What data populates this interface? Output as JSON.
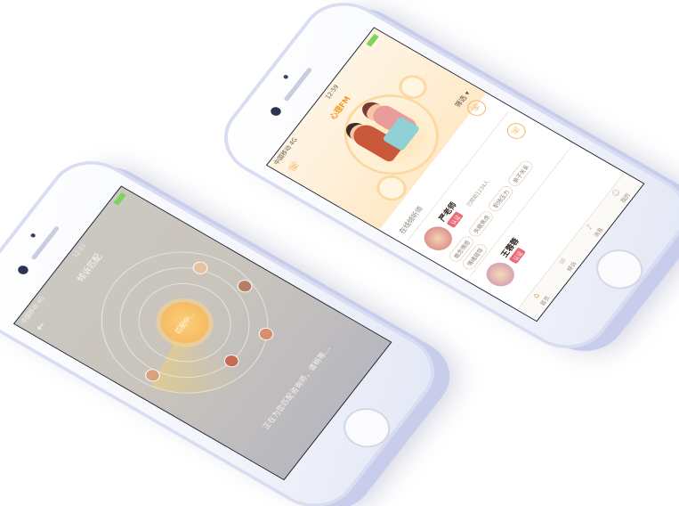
{
  "left_phone": {
    "status": {
      "carrier": "中国移动 4G",
      "time": "12:01"
    },
    "nav": {
      "back_icon": "back-arrow-icon",
      "title": "倾诉匹配"
    },
    "radar": {
      "center_label": "匹配中..."
    },
    "waiting_text": "正在为您匹配咨询师，请稍等..."
  },
  "right_phone": {
    "status": {
      "carrier": "中国移动 4G",
      "time": "12:59"
    },
    "header": {
      "title": "心理FM",
      "call_icon": "phone-icon"
    },
    "sort_label": "筛选 ▾",
    "section_title": "在线倾听师",
    "cards": [
      {
        "name": "严老师",
        "badge": "认证",
        "meta": "已帮助1234人",
        "tags": [
          "婚恋情感",
          "失眠焦虑",
          "职场压力",
          "亲子关系",
          "情绪疏导"
        ]
      },
      {
        "name": "王蓉蓉",
        "badge": "认证",
        "meta": "",
        "tags": []
      }
    ],
    "tabbar": [
      "首页",
      "倾诉",
      "消息",
      "我的"
    ]
  },
  "colors": {
    "accent": "#f39a21",
    "badge": "#ef6a78",
    "battery": "#7cd55a"
  }
}
